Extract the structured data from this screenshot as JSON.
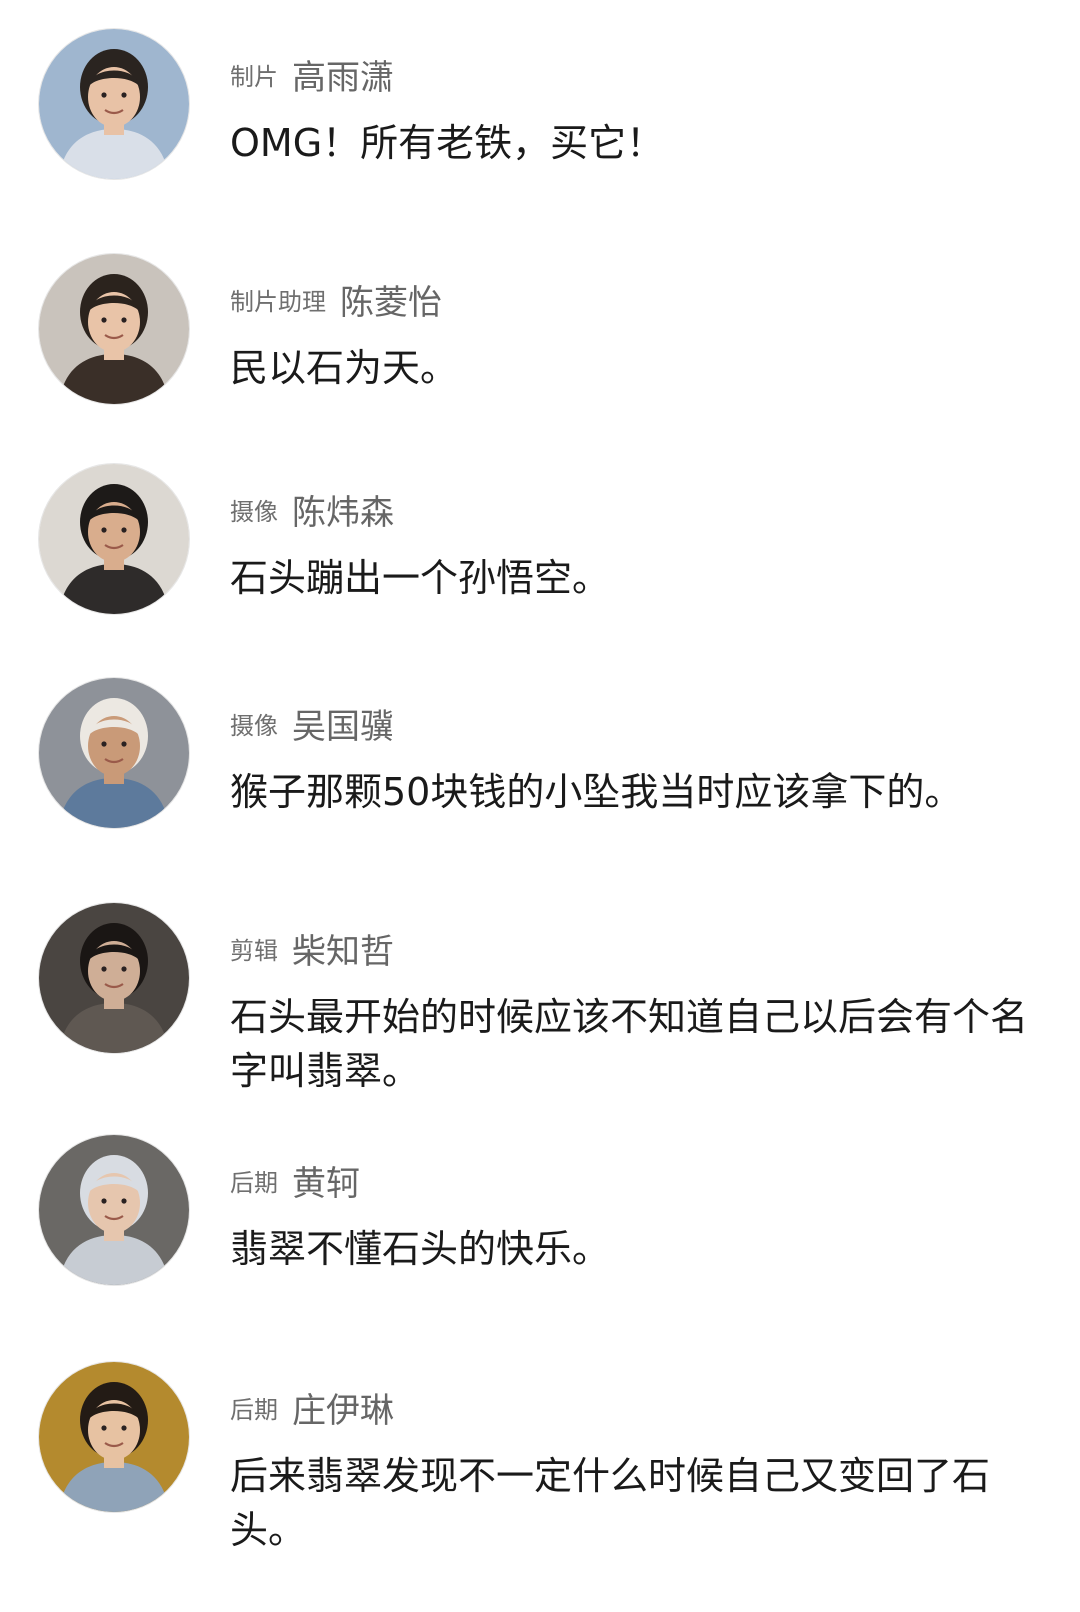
{
  "comments": [
    {
      "role": "制片",
      "name": "高雨潇",
      "text": "OMG！所有老铁，买它！",
      "avatar_icon": "person-avatar",
      "colors": {
        "bg": "#9fb6cf",
        "hair": "#2a2420",
        "face": "#e8c2a6",
        "shirt": "#d9dfe8"
      }
    },
    {
      "role": "制片助理",
      "name": "陈菱怡",
      "text": "民以石为天。",
      "avatar_icon": "person-avatar",
      "colors": {
        "bg": "#c9c3bc",
        "hair": "#2b231d",
        "face": "#e9c4a8",
        "shirt": "#3a2f28"
      }
    },
    {
      "role": "摄像",
      "name": "陈炜森",
      "text": "石头蹦出一个孙悟空。",
      "avatar_icon": "person-avatar",
      "colors": {
        "bg": "#dcd8d2",
        "hair": "#1d1a18",
        "face": "#d9ad8d",
        "shirt": "#2e2b2a"
      }
    },
    {
      "role": "摄像",
      "name": "吴国骥",
      "text": "猴子那颗50块钱的小坠我当时应该拿下的。",
      "avatar_icon": "person-avatar",
      "colors": {
        "bg": "#8e9299",
        "hair": "#ece8e2",
        "face": "#c99a78",
        "shirt": "#5d7a9c"
      }
    },
    {
      "role": "剪辑",
      "name": "柴知哲",
      "text": "石头最开始的时候应该不知道自己以后会有个名字叫翡翠。",
      "avatar_icon": "person-avatar",
      "colors": {
        "bg": "#4a4541",
        "hair": "#1a1614",
        "face": "#cfae96",
        "shirt": "#5f5852"
      }
    },
    {
      "role": "后期",
      "name": "黄轲",
      "text": "翡翠不懂石头的快乐。",
      "avatar_icon": "person-avatar",
      "colors": {
        "bg": "#6a6865",
        "hair": "#d8dce2",
        "face": "#e6c6ae",
        "shirt": "#c7ccd3"
      }
    },
    {
      "role": "后期",
      "name": "庄伊琳",
      "text": "后来翡翠发现不一定什么时候自己又变回了石头。",
      "avatar_icon": "person-avatar",
      "colors": {
        "bg": "#b48a2e",
        "hair": "#231b15",
        "face": "#e7c2a2",
        "shirt": "#8fa3b8"
      }
    }
  ]
}
